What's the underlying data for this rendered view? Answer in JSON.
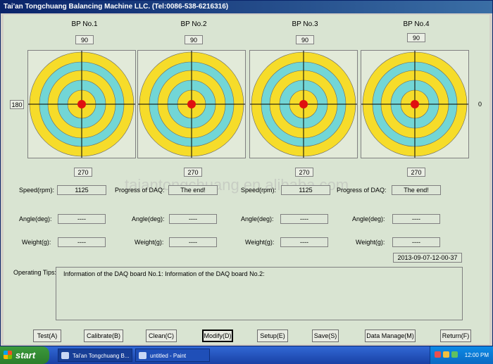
{
  "window": {
    "title": "Tai'an Tongchuang Balancing Machine LLC. (Tel:0086-538-6216316)"
  },
  "bp": [
    {
      "title": "BP No.1",
      "top": "90",
      "bottom": "270"
    },
    {
      "title": "BP No.2",
      "top": "90",
      "bottom": "270"
    },
    {
      "title": "BP No.3",
      "top": "90",
      "bottom": "270"
    },
    {
      "title": "BP No.4",
      "top": "90",
      "bottom": "270"
    }
  ],
  "side": {
    "left": "180",
    "right": "0"
  },
  "watermark": "taiantongchuang.en.alibaba.com",
  "labels": {
    "speed": "Speed(rpm):",
    "progress": "Progress of DAQ:",
    "angle": "Angle(deg):",
    "weight": "Weight(g):",
    "tips": "Operating Tips:"
  },
  "values": {
    "speed1": "1125",
    "progress1": "The end!",
    "speed2": "1125",
    "progress2": "The end!",
    "angle": [
      "----",
      "----",
      "----",
      "----"
    ],
    "weight": [
      "----",
      "----",
      "----",
      "----"
    ]
  },
  "timestamp": "2013-09-07-12-00-37",
  "tips_text": "Information of the DAQ board No.1:    Information of the DAQ board No.2:",
  "buttons": [
    "Test(A)",
    "Calibrate(B)",
    "Clean(C)",
    "Modify(D)",
    "Setup(E)",
    "Save(S)",
    "Data Manage(M)",
    "Return(F)"
  ],
  "taskbar": {
    "start": "start",
    "tasks": [
      "Tai'an Tongchuang B...",
      "untitled - Paint"
    ],
    "clock": "12:00 PM"
  },
  "colors": {
    "ring_yellow": "#f6dc2a",
    "ring_cyan": "#72d6d6",
    "center_red": "#e01010"
  }
}
